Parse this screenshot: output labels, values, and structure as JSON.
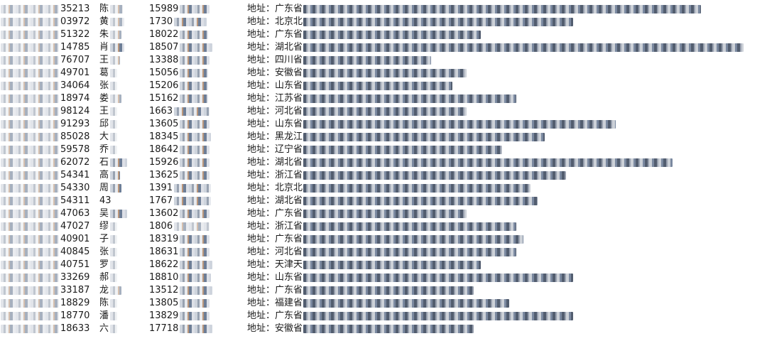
{
  "rows": [
    {
      "order": "35213",
      "name": "陈",
      "phone": "15989",
      "addr": "地址：广东省"
    },
    {
      "order": "03972",
      "name": "黄",
      "phone": "1730",
      "addr": "地址：北京北"
    },
    {
      "order": "51322",
      "name": "朱",
      "phone": "18022",
      "addr": "地址：广东省"
    },
    {
      "order": "14785",
      "name": "肖",
      "phone": "18507",
      "addr": "地址：湖北省"
    },
    {
      "order": "76707",
      "name": "王",
      "phone": "13388",
      "addr": "地址：四川省"
    },
    {
      "order": "49701",
      "name": "葛",
      "phone": "15056",
      "addr": "地址：安徽省"
    },
    {
      "order": "34064",
      "name": "张",
      "phone": "15206",
      "addr": "地址：山东省"
    },
    {
      "order": "18974",
      "name": "娄",
      "phone": "15162",
      "addr": "地址：江苏省"
    },
    {
      "order": "98124",
      "name": "王",
      "phone": "1663",
      "addr": "地址：河北省"
    },
    {
      "order": "91293",
      "name": "邱",
      "phone": "13605",
      "addr": "地址：山东省"
    },
    {
      "order": "85028",
      "name": "大",
      "phone": "18345",
      "addr": "地址：黑龙江"
    },
    {
      "order": "59578",
      "name": "乔",
      "phone": "18642",
      "addr": "地址：辽宁省"
    },
    {
      "order": "62072",
      "name": "石",
      "phone": "15926",
      "addr": "地址：湖北省"
    },
    {
      "order": "54341",
      "name": "高",
      "phone": "13625",
      "addr": "地址：浙江省"
    },
    {
      "order": "54330",
      "name": "周",
      "phone": "1391",
      "addr": "地址：北京北"
    },
    {
      "order": "54311",
      "name": "43",
      "phone": "1767",
      "addr": "地址：湖北省"
    },
    {
      "order": "47063",
      "name": "吴",
      "phone": "13602",
      "addr": "地址：广东省"
    },
    {
      "order": "47027",
      "name": "缪",
      "phone": "1806",
      "addr": "地址：浙江省"
    },
    {
      "order": "40901",
      "name": "子",
      "phone": "18319",
      "addr": "地址：广东省"
    },
    {
      "order": "40845",
      "name": "张",
      "phone": "18631",
      "addr": "地址：河北省"
    },
    {
      "order": "40751",
      "name": "罗",
      "phone": "18622",
      "addr": "地址：天津天"
    },
    {
      "order": "33269",
      "name": "郝",
      "phone": "18810",
      "addr": "地址：山东省"
    },
    {
      "order": "33187",
      "name": "龙",
      "phone": "13512",
      "addr": "地址：广东省"
    },
    {
      "order": "18829",
      "name": "陈",
      "phone": "13805",
      "addr": "地址：福建省"
    },
    {
      "order": "18770",
      "name": "潘",
      "phone": "13829",
      "addr": "地址：广东省"
    },
    {
      "order": "18633",
      "name": "六",
      "phone": "17718",
      "addr": "地址：安徽省"
    }
  ]
}
